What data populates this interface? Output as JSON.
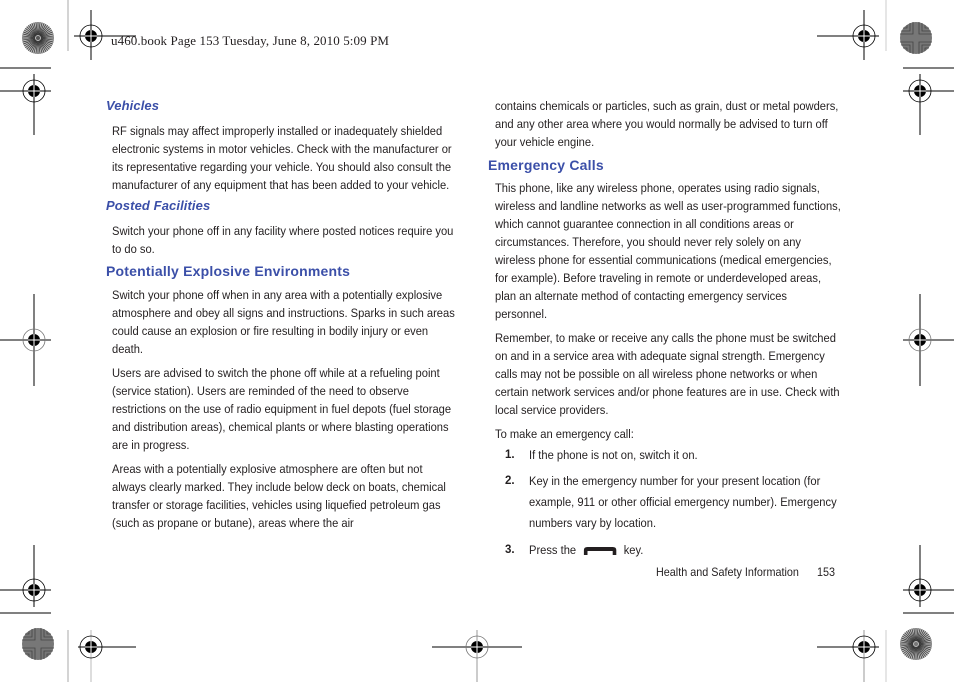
{
  "header": {
    "slug": "u460.book  Page 153  Tuesday, June 8, 2010  5:09 PM"
  },
  "left_column": {
    "sections": [
      {
        "heading": "Vehicles",
        "paragraphs": [
          "RF signals may affect improperly installed or inadequately shielded electronic systems in motor vehicles. Check with the manufacturer or its representative regarding your vehicle. You should also consult the manufacturer of any equipment that has been added to your vehicle."
        ]
      },
      {
        "heading": "Posted Facilities",
        "paragraphs": [
          "Switch your phone off in any facility where posted notices require you to do so."
        ]
      },
      {
        "heading": "Potentially Explosive Environments",
        "paragraphs": [
          "Switch your phone off when in any area with a potentially explosive atmosphere and obey all signs and instructions. Sparks in such areas could cause an explosion or fire resulting in bodily injury or even death.",
          "Users are advised to switch the phone off while at a refueling point (service station). Users are reminded of the need to observe restrictions on the use of radio equipment in fuel depots (fuel storage and distribution areas), chemical plants or where blasting operations are in progress.",
          "Areas with a potentially explosive atmosphere are often but not always clearly marked. They include below deck on boats, chemical transfer or storage facilities, vehicles using liquefied petroleum gas (such as propane or butane), areas where the air"
        ]
      }
    ]
  },
  "right_column": {
    "continuation": "contains chemicals or particles, such as grain, dust or metal powders, and any other area where you would normally be advised to turn off your vehicle engine.",
    "section": {
      "heading": "Emergency Calls",
      "paragraphs": [
        "This phone, like any wireless phone, operates using radio signals, wireless and landline networks as well as user-programmed functions, which cannot guarantee connection in all conditions areas or circumstances. Therefore, you should never rely solely on any wireless phone for essential communications (medical emergencies, for example). Before traveling in remote or underdeveloped areas, plan an alternate method of contacting emergency services personnel.",
        "Remember, to make or receive any calls the phone must be switched on and in a service area with adequate signal strength. Emergency calls may not be possible on all wireless phone networks or when certain network services and/or phone features are in use. Check with local service providers.",
        "To make an emergency call:"
      ],
      "steps": [
        {
          "number": "1.",
          "text": "If the phone is not on, switch it on."
        },
        {
          "number": "2.",
          "text": "Key in the emergency number for your present location (for example, 911 or other official emergency number). Emergency numbers vary by location."
        },
        {
          "number": "3.",
          "text_before": "Press the",
          "icon": "send-key-icon",
          "text_after": "key."
        }
      ]
    }
  },
  "footer": {
    "section_title": "Health and Safety Information",
    "page_number": "153"
  },
  "colors": {
    "heading": "#3b4fa8",
    "body_text": "#231f20"
  }
}
